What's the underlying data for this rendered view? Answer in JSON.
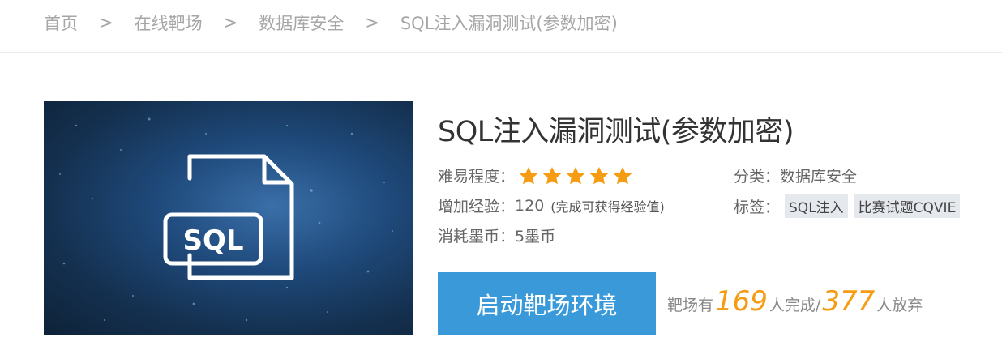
{
  "breadcrumb": {
    "items": [
      "首页",
      "在线靶场",
      "数据库安全",
      "SQL注入漏洞测试(参数加密)"
    ],
    "separator": ">"
  },
  "cover": {
    "icon_label": "SQL",
    "icon": "sql-file-icon"
  },
  "title": "SQL注入漏洞测试(参数加密)",
  "difficulty": {
    "label": "难易程度：",
    "stars": 5,
    "max": 5,
    "star_color": "#f59c12"
  },
  "experience": {
    "label": "增加经验：",
    "value": "120",
    "note": "(完成可获得经验值)"
  },
  "cost": {
    "label": "消耗墨币：",
    "value": "5墨币"
  },
  "category": {
    "label": "分类：",
    "value": "数据库安全"
  },
  "tags": {
    "label": "标签：",
    "items": [
      "SQL注入",
      "比赛试题CQVIE"
    ]
  },
  "start_button": "启动靶场环境",
  "stats": {
    "prefix": "靶场有",
    "completed": "169",
    "completed_suffix": "人完成/",
    "abandoned": "377",
    "abandoned_suffix": "人放弃"
  },
  "colors": {
    "accent": "#3a9ad9",
    "highlight": "#f59c12"
  }
}
